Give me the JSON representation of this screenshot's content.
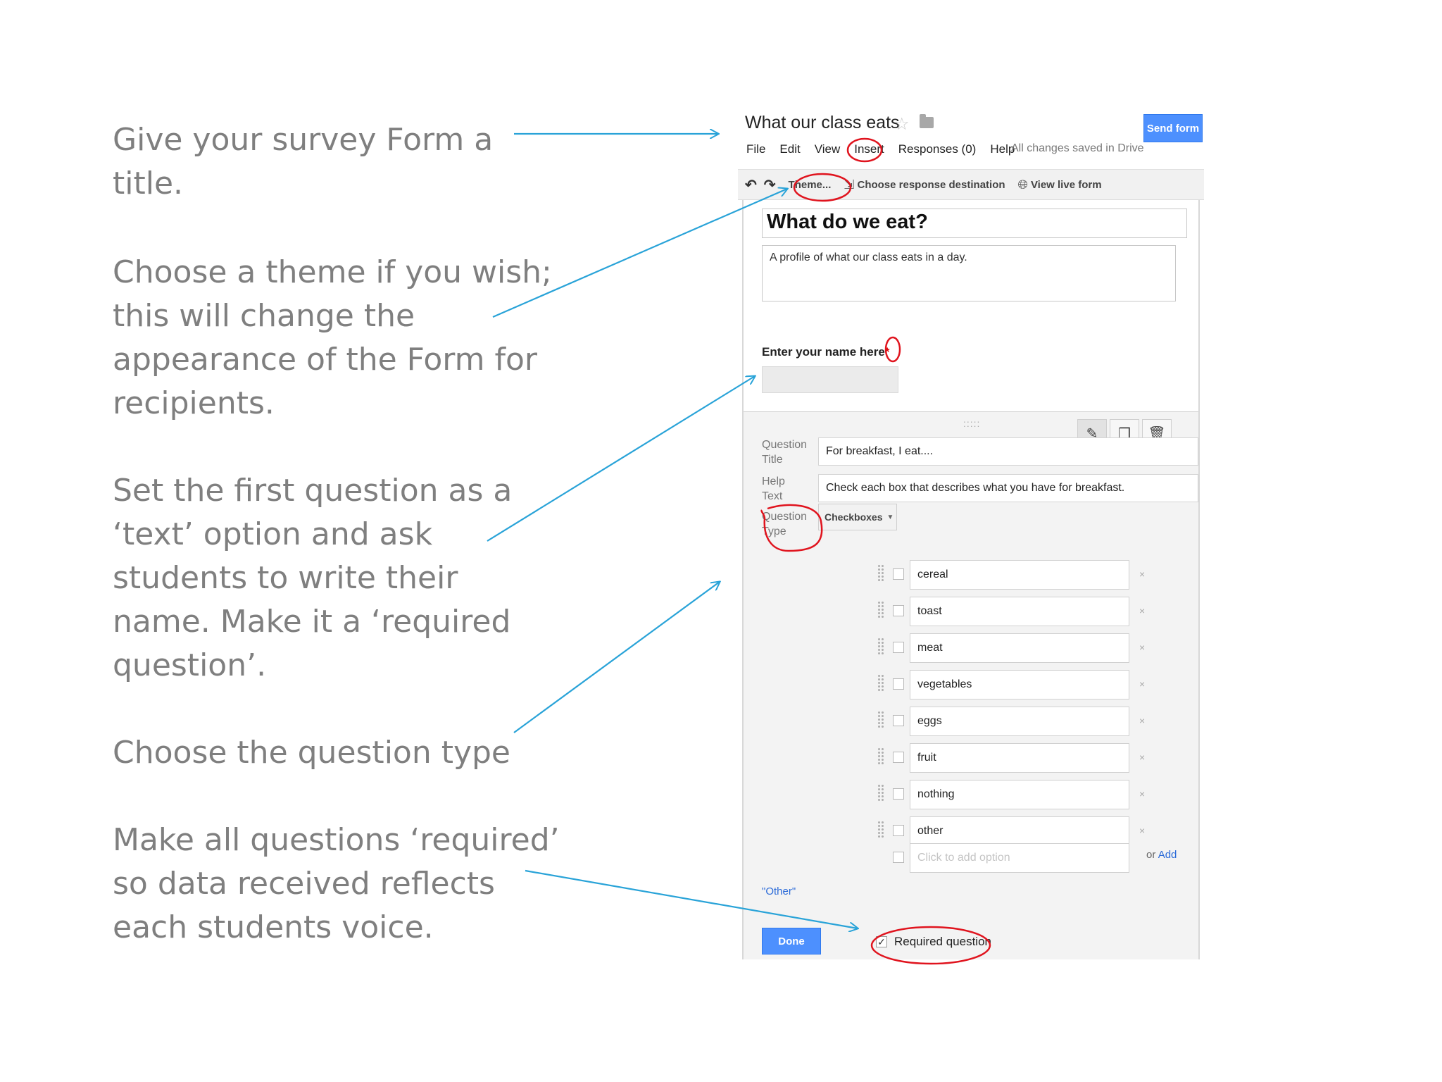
{
  "instructions": [
    "Give your survey Form a\ntitle.",
    "Choose a theme if you wish;\nthis will change the\nappearance of the Form for\nrecipients.",
    "Set the first question as a\n‘text’ option and ask\nstudents to write their\nname. Make it a ‘required\nquestion’.",
    "Choose the question type",
    "Make all questions ‘required’\nso data received reflects\neach students voice."
  ],
  "app": {
    "doc_title": "What our class eats",
    "send_label": "Send form",
    "menu": [
      "File",
      "Edit",
      "View",
      "Insert",
      "Responses (0)",
      "Help"
    ],
    "saved_status": "All changes saved in Drive",
    "toolbar": {
      "theme_label": "Theme...",
      "response_dest_label": "Choose response destination",
      "live_form_label": "View live form"
    }
  },
  "form": {
    "title": "What do we eat?",
    "description": "A profile of what our class eats in a day.",
    "q1_label": "Enter your name here",
    "q1_required_mark": "*"
  },
  "editor": {
    "question_title_label": "Question Title",
    "question_title_value": "For breakfast, I eat....",
    "help_text_label": "Help Text",
    "help_text_value": "Check each box that describes what you have for breakfast.",
    "question_type_label": "Question Type",
    "question_type_value": "Checkboxes",
    "options": [
      "cereal",
      "toast",
      "meat",
      "vegetables",
      "eggs",
      "fruit",
      "nothing",
      "other"
    ],
    "add_option_placeholder": "Click to add option",
    "or_text": "or",
    "add_text": "Add",
    "other_link": "\"Other\"",
    "done_label": "Done",
    "required_label": "Required question",
    "required_checked": true
  },
  "colors": {
    "accent_blue": "#4d90fe",
    "arrow": "#29a3d8",
    "circle": "#e0141e",
    "instruction_text": "#7f7f7f"
  }
}
